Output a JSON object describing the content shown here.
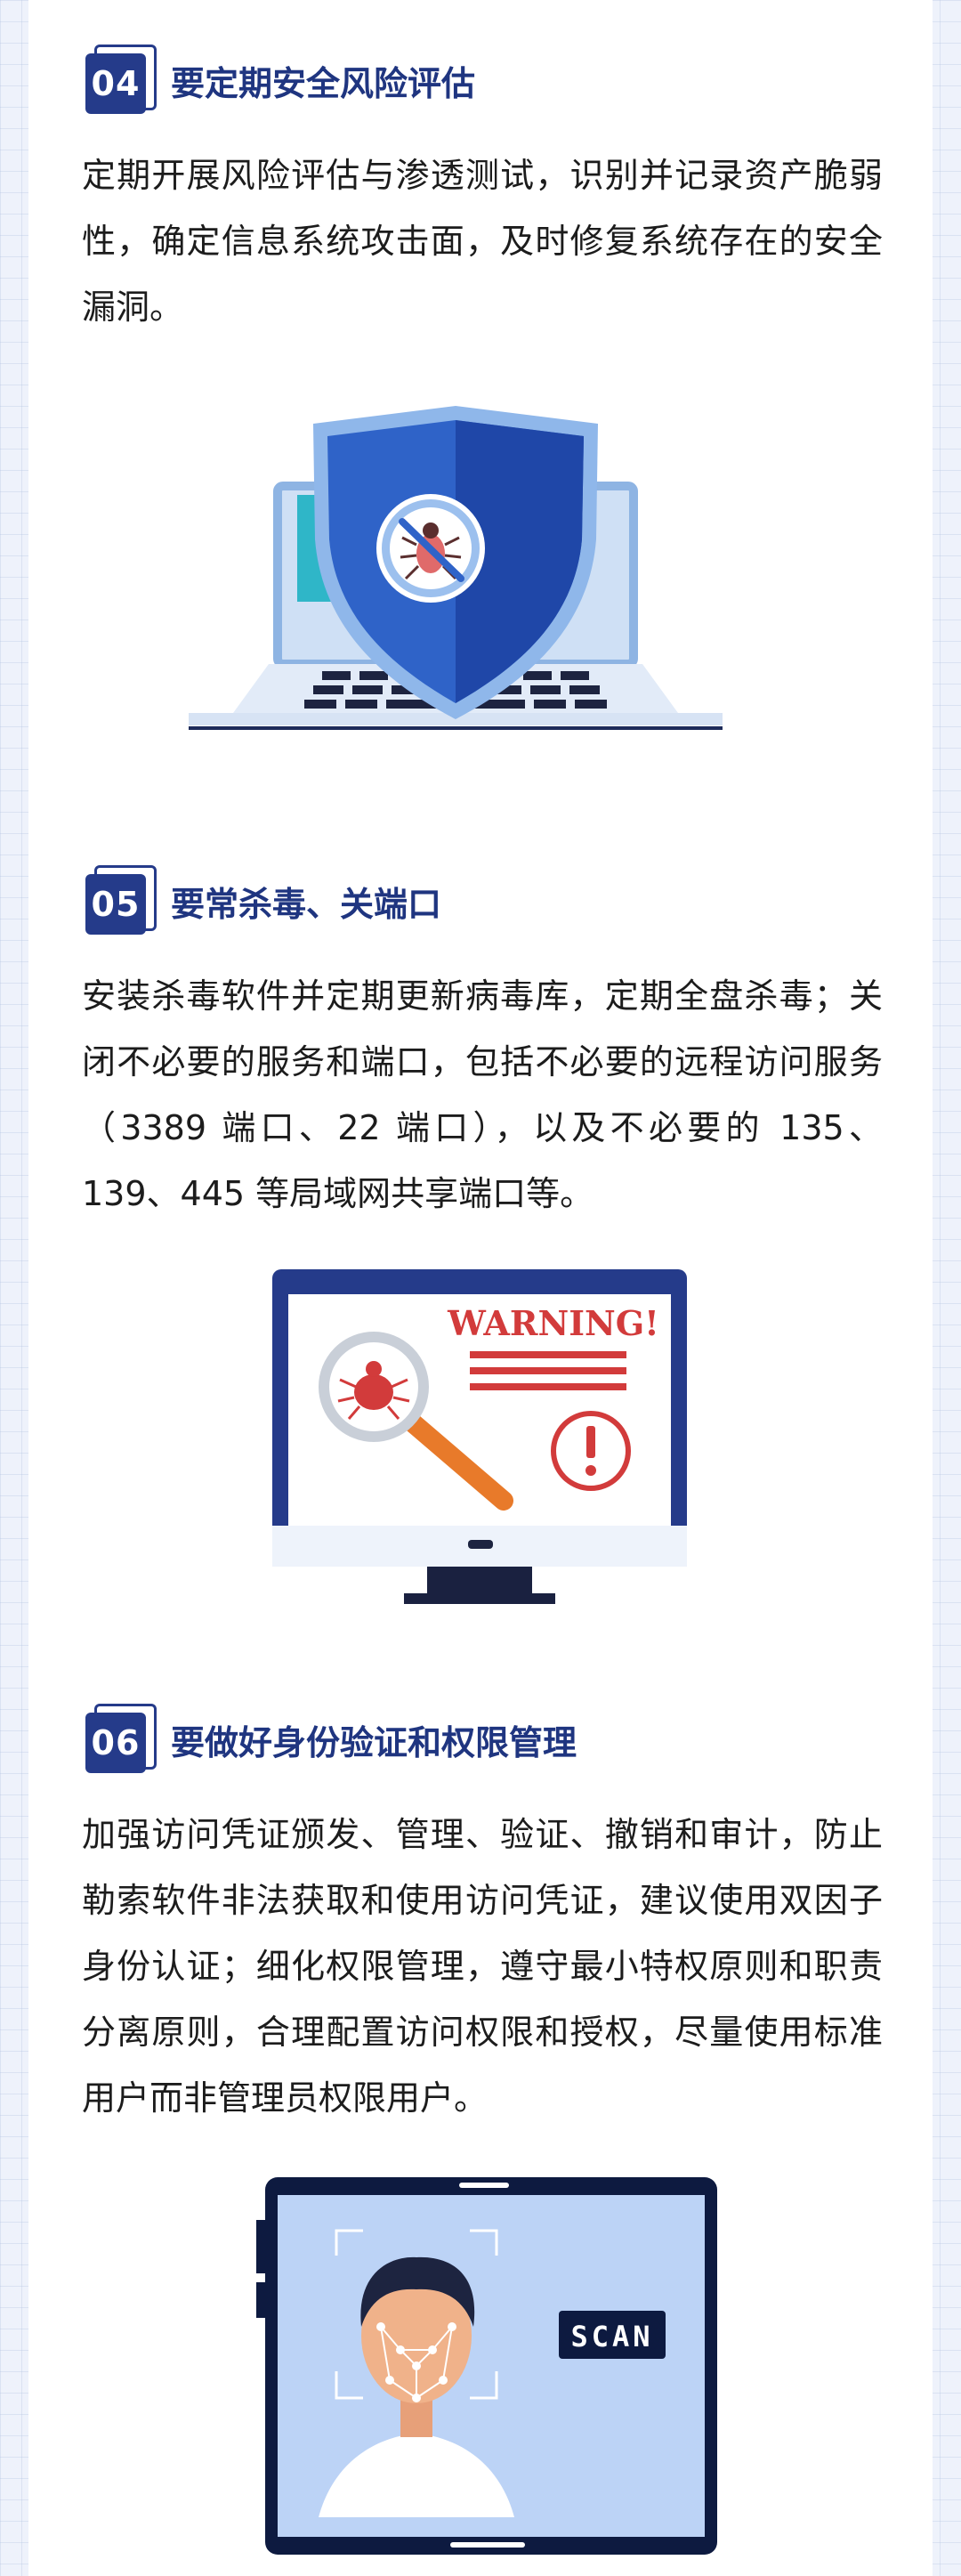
{
  "sections": [
    {
      "number": "04",
      "title": "要定期安全风险评估",
      "body": "定期开展风险评估与渗透测试，识别并记录资产脆弱性，确定信息系统攻击面，及时修复系统存在的安全漏洞。",
      "illustration": "shield-laptop"
    },
    {
      "number": "05",
      "title": "要常杀毒、关端口",
      "body": "安装杀毒软件并定期更新病毒库，定期全盘杀毒；关闭不必要的服务和端口，包括不必要的远程访问服务（3389 端口、22 端口），以及不必要的 135、139、445 等局域网共享端口等。",
      "illustration": "warning-monitor",
      "warning_text": "WARNING!"
    },
    {
      "number": "06",
      "title": "要做好身份验证和权限管理",
      "body": "加强访问凭证颁发、管理、验证、撤销和审计，防止勒索软件非法获取和使用访问凭证，建议使用双因子身份认证；细化权限管理，遵守最小特权原则和职责分离原则，合理配置访问权限和授权，尽量使用标准用户而非管理员权限用户。",
      "illustration": "face-scan-tablet",
      "scan_text": "SCAN"
    }
  ],
  "colors": {
    "brand_navy": "#253b8a",
    "heading": "#1f3580",
    "shield_blue": "#2f63c8",
    "warning_red": "#d23b3b",
    "scan_bg": "#bcd3f6"
  }
}
